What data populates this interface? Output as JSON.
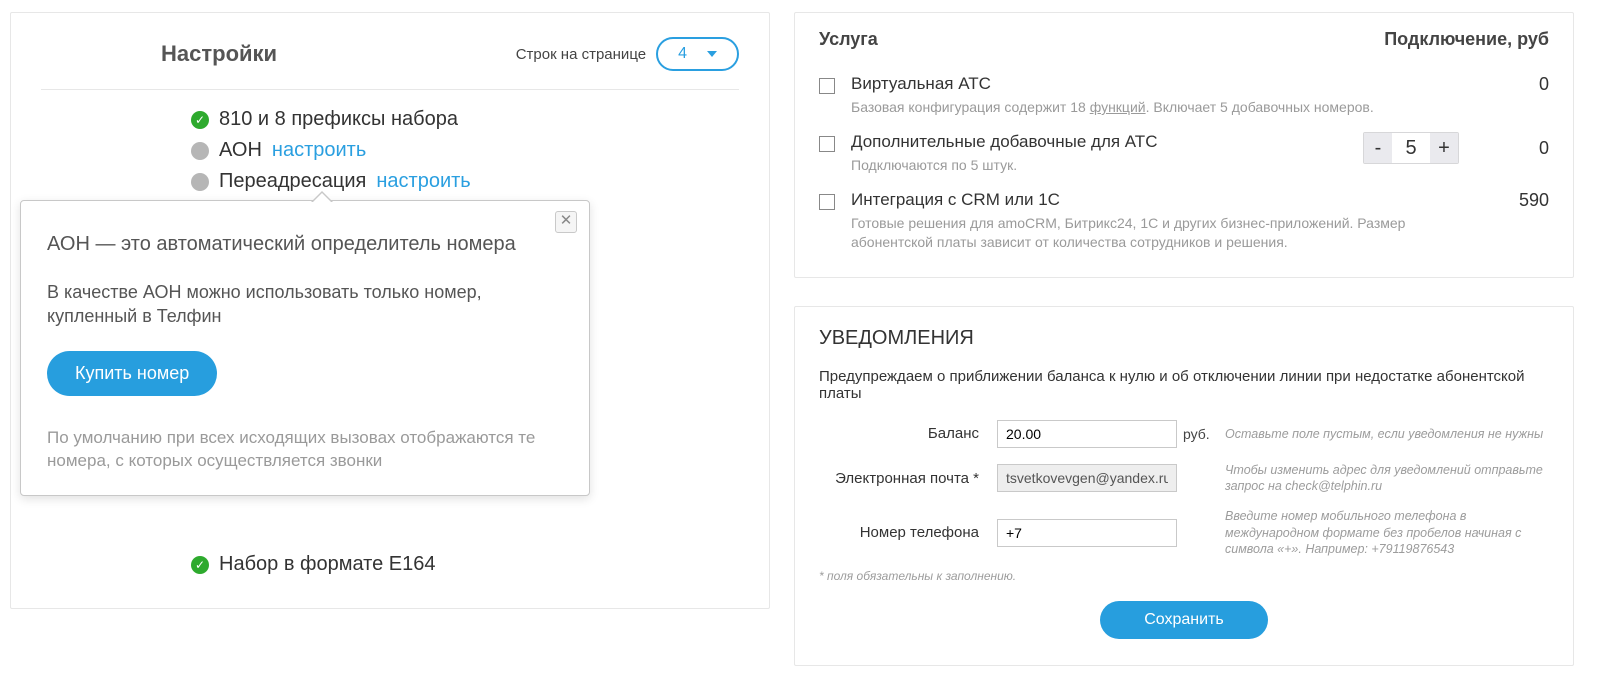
{
  "settings": {
    "title": "Настройки",
    "rows_label": "Строк на странице",
    "rows_value": "4",
    "items": [
      {
        "status": "green",
        "label": "810 и 8 префиксы набора"
      },
      {
        "status": "gray",
        "label": "АОН",
        "action": "настроить"
      },
      {
        "status": "gray",
        "label": "Переадресация",
        "action": "настроить"
      },
      {
        "status": "green",
        "label": "Набор в формате E164"
      }
    ]
  },
  "popover": {
    "close_glyph": "✕",
    "title": "АОН — это автоматический определитель номера",
    "body": "В качестве АОН можно использовать только номер, купленный в Телфин",
    "buy_label": "Купить номер",
    "note": "По умолчанию при всех исходящих вызовах отображаются те номера, с которых осуществляется звонки"
  },
  "services": {
    "header_service": "Услуга",
    "header_price": "Подключение, руб",
    "rows": [
      {
        "title": "Виртуальная АТС",
        "desc_pre": "Базовая конфигурация содержит 18 ",
        "desc_link": "функций",
        "desc_post": ". Включает 5 добавочных номеров.",
        "price": "0"
      },
      {
        "title": "Дополнительные добавочные для АТС",
        "desc": "Подключаются по 5 штук.",
        "stepper": "5",
        "price": "0"
      },
      {
        "title": "Интеграция с CRM или 1С",
        "desc": "Готовые решения для amoCRM, Битрикс24, 1С и других бизнес-приложений. Размер абонентской платы зависит от количества сотрудников и решения.",
        "price": "590"
      }
    ],
    "stepper_minus": "-",
    "stepper_plus": "+"
  },
  "notif": {
    "title": "УВЕДОМЛЕНИЯ",
    "subtitle": "Предупреждаем о приближении баланса к нулю и об отключении линии при недостатке абонентской платы",
    "balance_label": "Баланс",
    "balance_value": "20.00",
    "balance_unit": "руб.",
    "balance_hint": "Оставьте поле пустым, если уведомления не нужны",
    "email_label": "Электронная почта *",
    "email_value": "tsvetkovevgen@yandex.ru",
    "email_hint": "Чтобы изменить адрес для уведомлений отправьте запрос на check@telphin.ru",
    "phone_label": "Номер телефона",
    "phone_value": "+7",
    "phone_hint": "Введите номер мобильного телефона в международном формате без пробелов начиная с символа «+». Например: +79119876543",
    "required_note": "* поля обязательны к заполнению.",
    "save_label": "Сохранить"
  }
}
